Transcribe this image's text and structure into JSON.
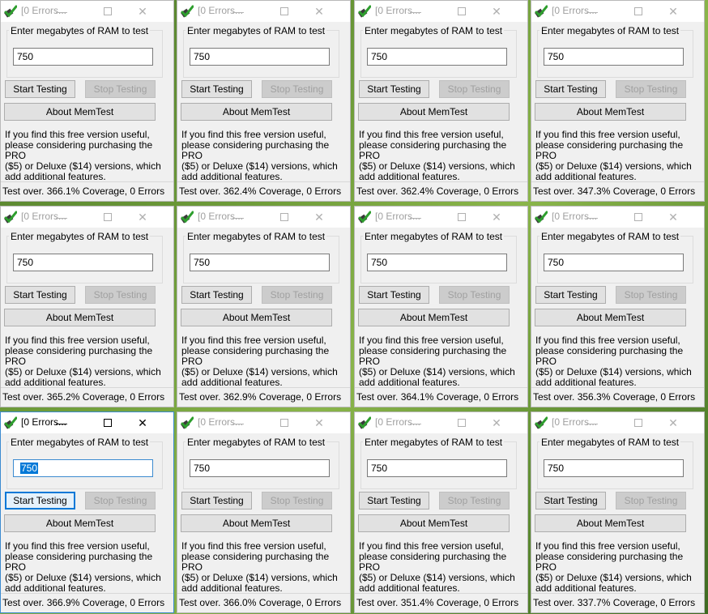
{
  "app": {
    "title": "[0 Errors...",
    "ram_label": "Enter megabytes of RAM to test",
    "ram_value": "750",
    "start_label": "Start Testing",
    "stop_label": "Stop Testing",
    "about_label": "About MemTest",
    "info_lines": [
      "If you find this free version useful,",
      "please considering purchasing the PRO",
      "($5) or Deluxe ($14) versions, which",
      "add additional features."
    ],
    "icons": {
      "app": "memtest-checkmark-icon",
      "minimize": "minimize-icon",
      "maximize": "maximize-icon",
      "close": "close-icon"
    }
  },
  "windows": [
    {
      "status": "Test over. 366.1% Coverage, 0 Errors"
    },
    {
      "status": "Test over. 362.4% Coverage, 0 Errors"
    },
    {
      "status": "Test over. 362.4% Coverage, 0 Errors"
    },
    {
      "status": "Test over. 347.3% Coverage, 0 Errors"
    },
    {
      "status": "Test over. 365.2% Coverage, 0 Errors"
    },
    {
      "status": "Test over. 362.9% Coverage, 0 Errors"
    },
    {
      "status": "Test over. 364.1% Coverage, 0 Errors"
    },
    {
      "status": "Test over. 356.3% Coverage, 0 Errors"
    },
    {
      "status": "Test over. 366.9% Coverage, 0 Errors",
      "active": true
    },
    {
      "status": "Test over. 366.0% Coverage, 0 Errors"
    },
    {
      "status": "Test over. 351.4% Coverage, 0 Errors"
    },
    {
      "status": "Test over. 337.7% Coverage, 0 Errors"
    }
  ],
  "colors": {
    "accent": "#0078d7",
    "window_bg": "#f0f0f0",
    "desktop": "#6f9d3a"
  }
}
